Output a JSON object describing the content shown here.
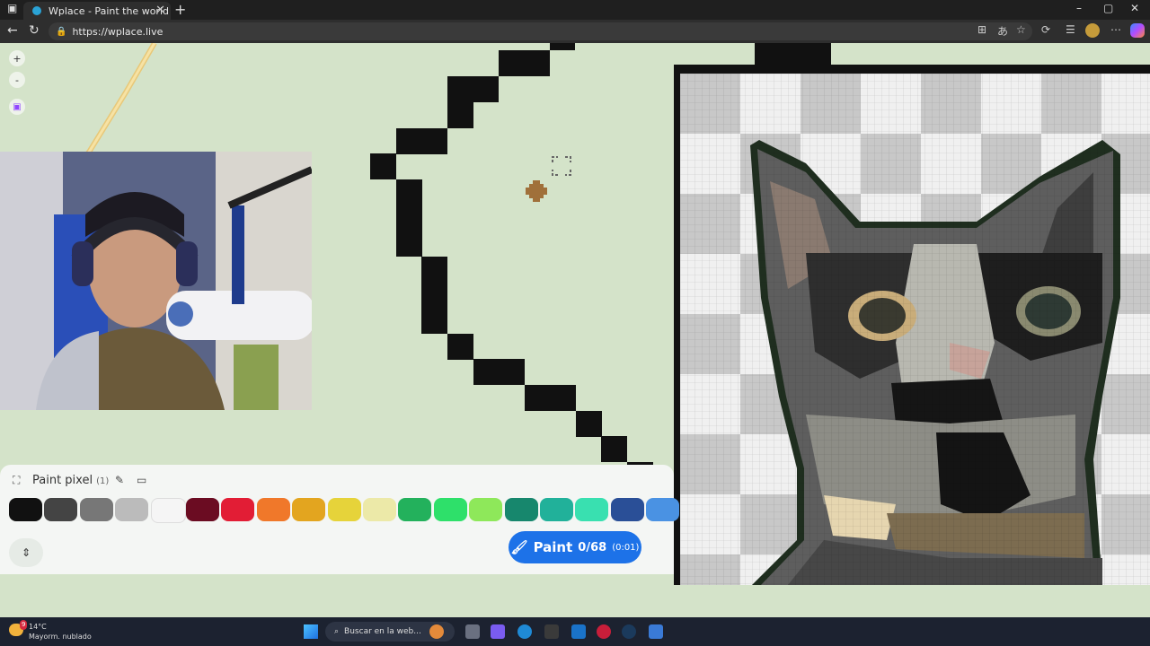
{
  "browser": {
    "tab_title": "Wplace - Paint the world",
    "tab_close": "✕",
    "new_tab": "+",
    "url": "https://wplace.live",
    "window_controls": {
      "minimize": "–",
      "maximize": "▢",
      "close": "✕"
    }
  },
  "map": {
    "zoom_in": "+",
    "zoom_out": "-",
    "twitch_icon": "twitch-icon"
  },
  "panel": {
    "title": "Paint pixel",
    "count": "(1)",
    "palette": [
      "#111111",
      "#444444",
      "#777777",
      "#bbbbbb",
      "#f5f5f5",
      "#6b0c22",
      "#e21d35",
      "#f0782a",
      "#e3a51f",
      "#e6d33a",
      "#ece9a8",
      "#23b15c",
      "#2ee06a",
      "#8ee85a",
      "#17876d",
      "#21b19a",
      "#39e0b0",
      "#2a4f97",
      "#4a92e3"
    ],
    "paint_label": "Paint",
    "paint_count": "0/68",
    "paint_timer": "(0:01)"
  },
  "taskbar": {
    "temperature": "14°C",
    "weather": "Mayorm. nublado",
    "weather_badge": "9",
    "search_placeholder": "Buscar en la web..."
  }
}
